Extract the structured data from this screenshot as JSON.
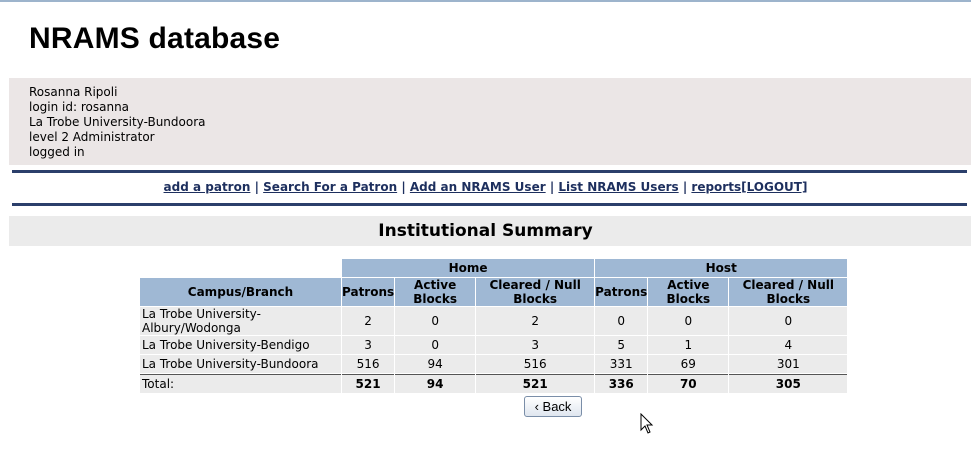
{
  "app": {
    "title": "NRAMS database"
  },
  "user": {
    "name": "Rosanna Ripoli",
    "login": "login id: rosanna",
    "institution": "La Trobe University-Bundoora",
    "level": "level 2 Administrator",
    "status": "logged in"
  },
  "nav": {
    "items": [
      "add a patron",
      "Search For a Patron",
      "Add an NRAMS User",
      "List NRAMS Users",
      "reports"
    ],
    "logout": "[LOGOUT]",
    "separator": "|"
  },
  "summary": {
    "title": "Institutional Summary",
    "group_headers": [
      "Home",
      "Host"
    ],
    "columns": [
      "Campus/Branch",
      "Patrons",
      "Active Blocks",
      "Cleared / Null Blocks",
      "Patrons",
      "Active Blocks",
      "Cleared / Null Blocks"
    ],
    "rows": [
      [
        "La Trobe University-Albury/Wodonga",
        "2",
        "0",
        "2",
        "0",
        "0",
        "0"
      ],
      [
        "La Trobe University-Bendigo",
        "3",
        "0",
        "3",
        "5",
        "1",
        "4"
      ],
      [
        "La Trobe University-Bundoora",
        "516",
        "94",
        "516",
        "331",
        "69",
        "301"
      ]
    ],
    "total": [
      "Total:",
      "521",
      "94",
      "521",
      "336",
      "70",
      "305"
    ]
  },
  "back_button": {
    "label": "Back",
    "icon": "chevron-left-icon"
  },
  "cursor_icon": "mouse-pointer-icon"
}
